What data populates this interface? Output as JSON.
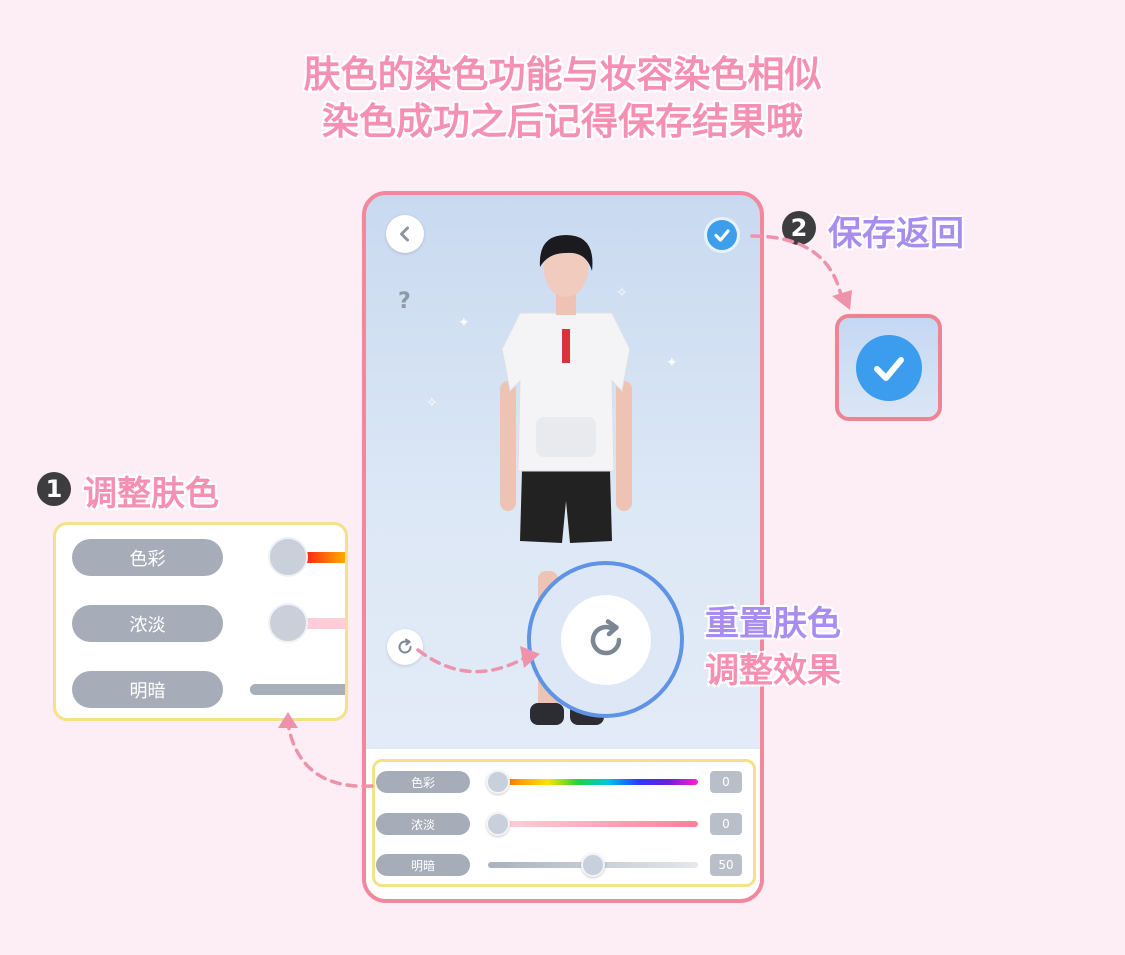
{
  "heading": {
    "line1": "肤色的染色功能与妆容染色相似",
    "line2": "染色成功之后记得保存结果哦"
  },
  "callouts": {
    "step1": {
      "number": "1",
      "label": "调整肤色",
      "color": "#f590b2"
    },
    "step2": {
      "number": "2",
      "label": "保存返回",
      "color": "#a88cf0"
    },
    "reset_line1": "重置肤色",
    "reset_line2": "调整效果"
  },
  "panel": {
    "rows": [
      {
        "label": "色彩",
        "value": "0",
        "level": 0
      },
      {
        "label": "浓淡",
        "value": "0",
        "level": 0
      },
      {
        "label": "明暗",
        "value": "50",
        "level": 50
      }
    ]
  },
  "zoom_panel": {
    "rows": [
      {
        "label": "色彩"
      },
      {
        "label": "浓淡"
      },
      {
        "label": "明暗"
      }
    ]
  },
  "phone": {
    "help": "?"
  },
  "icons": {
    "back": "chevron-left-icon",
    "confirm": "check-icon",
    "reset": "reset-icon",
    "help": "question-icon"
  },
  "colors": {
    "accent_pink": "#f2879e",
    "accent_blue": "#3f9eea",
    "highlight_yellow": "#f5e18a",
    "pill_gray": "#a6adb8"
  }
}
